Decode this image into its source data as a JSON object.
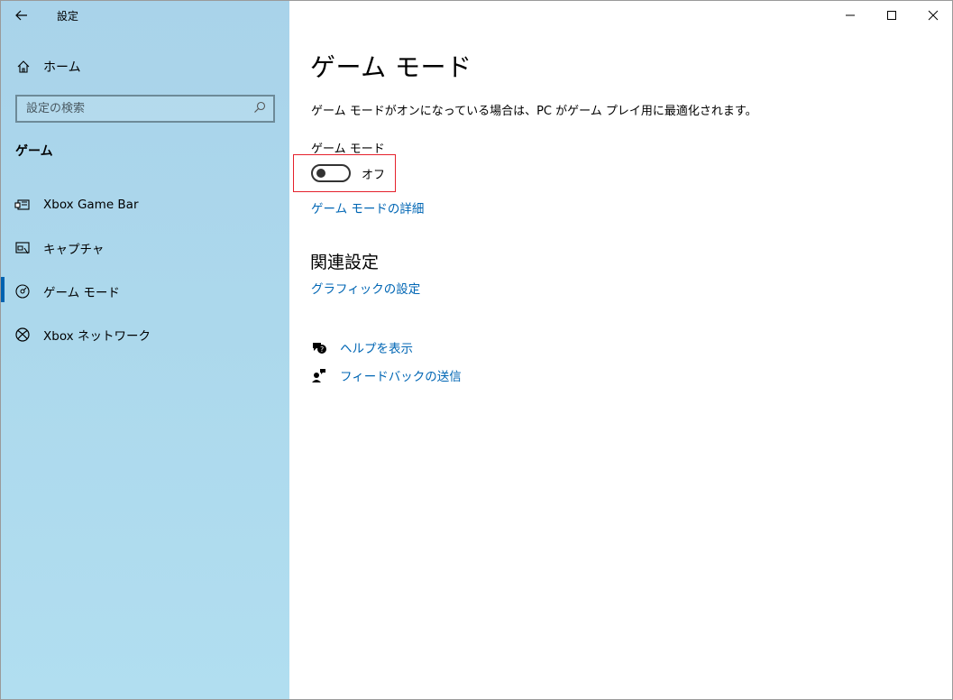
{
  "window": {
    "app_title": "設定"
  },
  "sidebar": {
    "home_label": "ホーム",
    "search": {
      "placeholder": "設定の検索"
    },
    "section_heading": "ゲーム",
    "items": [
      {
        "label": "Xbox Game Bar",
        "icon": "xbox-game-bar-icon",
        "active": false
      },
      {
        "label": "キャプチャ",
        "icon": "capture-icon",
        "active": false
      },
      {
        "label": "ゲーム モード",
        "icon": "game-mode-icon",
        "active": true
      },
      {
        "label": "Xbox ネットワーク",
        "icon": "xbox-icon",
        "active": false
      }
    ]
  },
  "main": {
    "title": "ゲーム モード",
    "description": "ゲーム モードがオンになっている場合は、PC がゲーム プレイ用に最適化されます。",
    "toggle": {
      "label": "ゲーム モード",
      "state_text": "オフ",
      "on": false
    },
    "details_link": "ゲーム モードの詳細",
    "related": {
      "title": "関連設定",
      "graphics_link": "グラフィックの設定"
    },
    "help": {
      "get_help": "ヘルプを表示",
      "feedback": "フィードバックの送信"
    }
  },
  "colors": {
    "accent": "#0063b1",
    "link": "#0066b4",
    "highlight": "#e5212c",
    "sidebar_bg": "#acd8ec"
  }
}
